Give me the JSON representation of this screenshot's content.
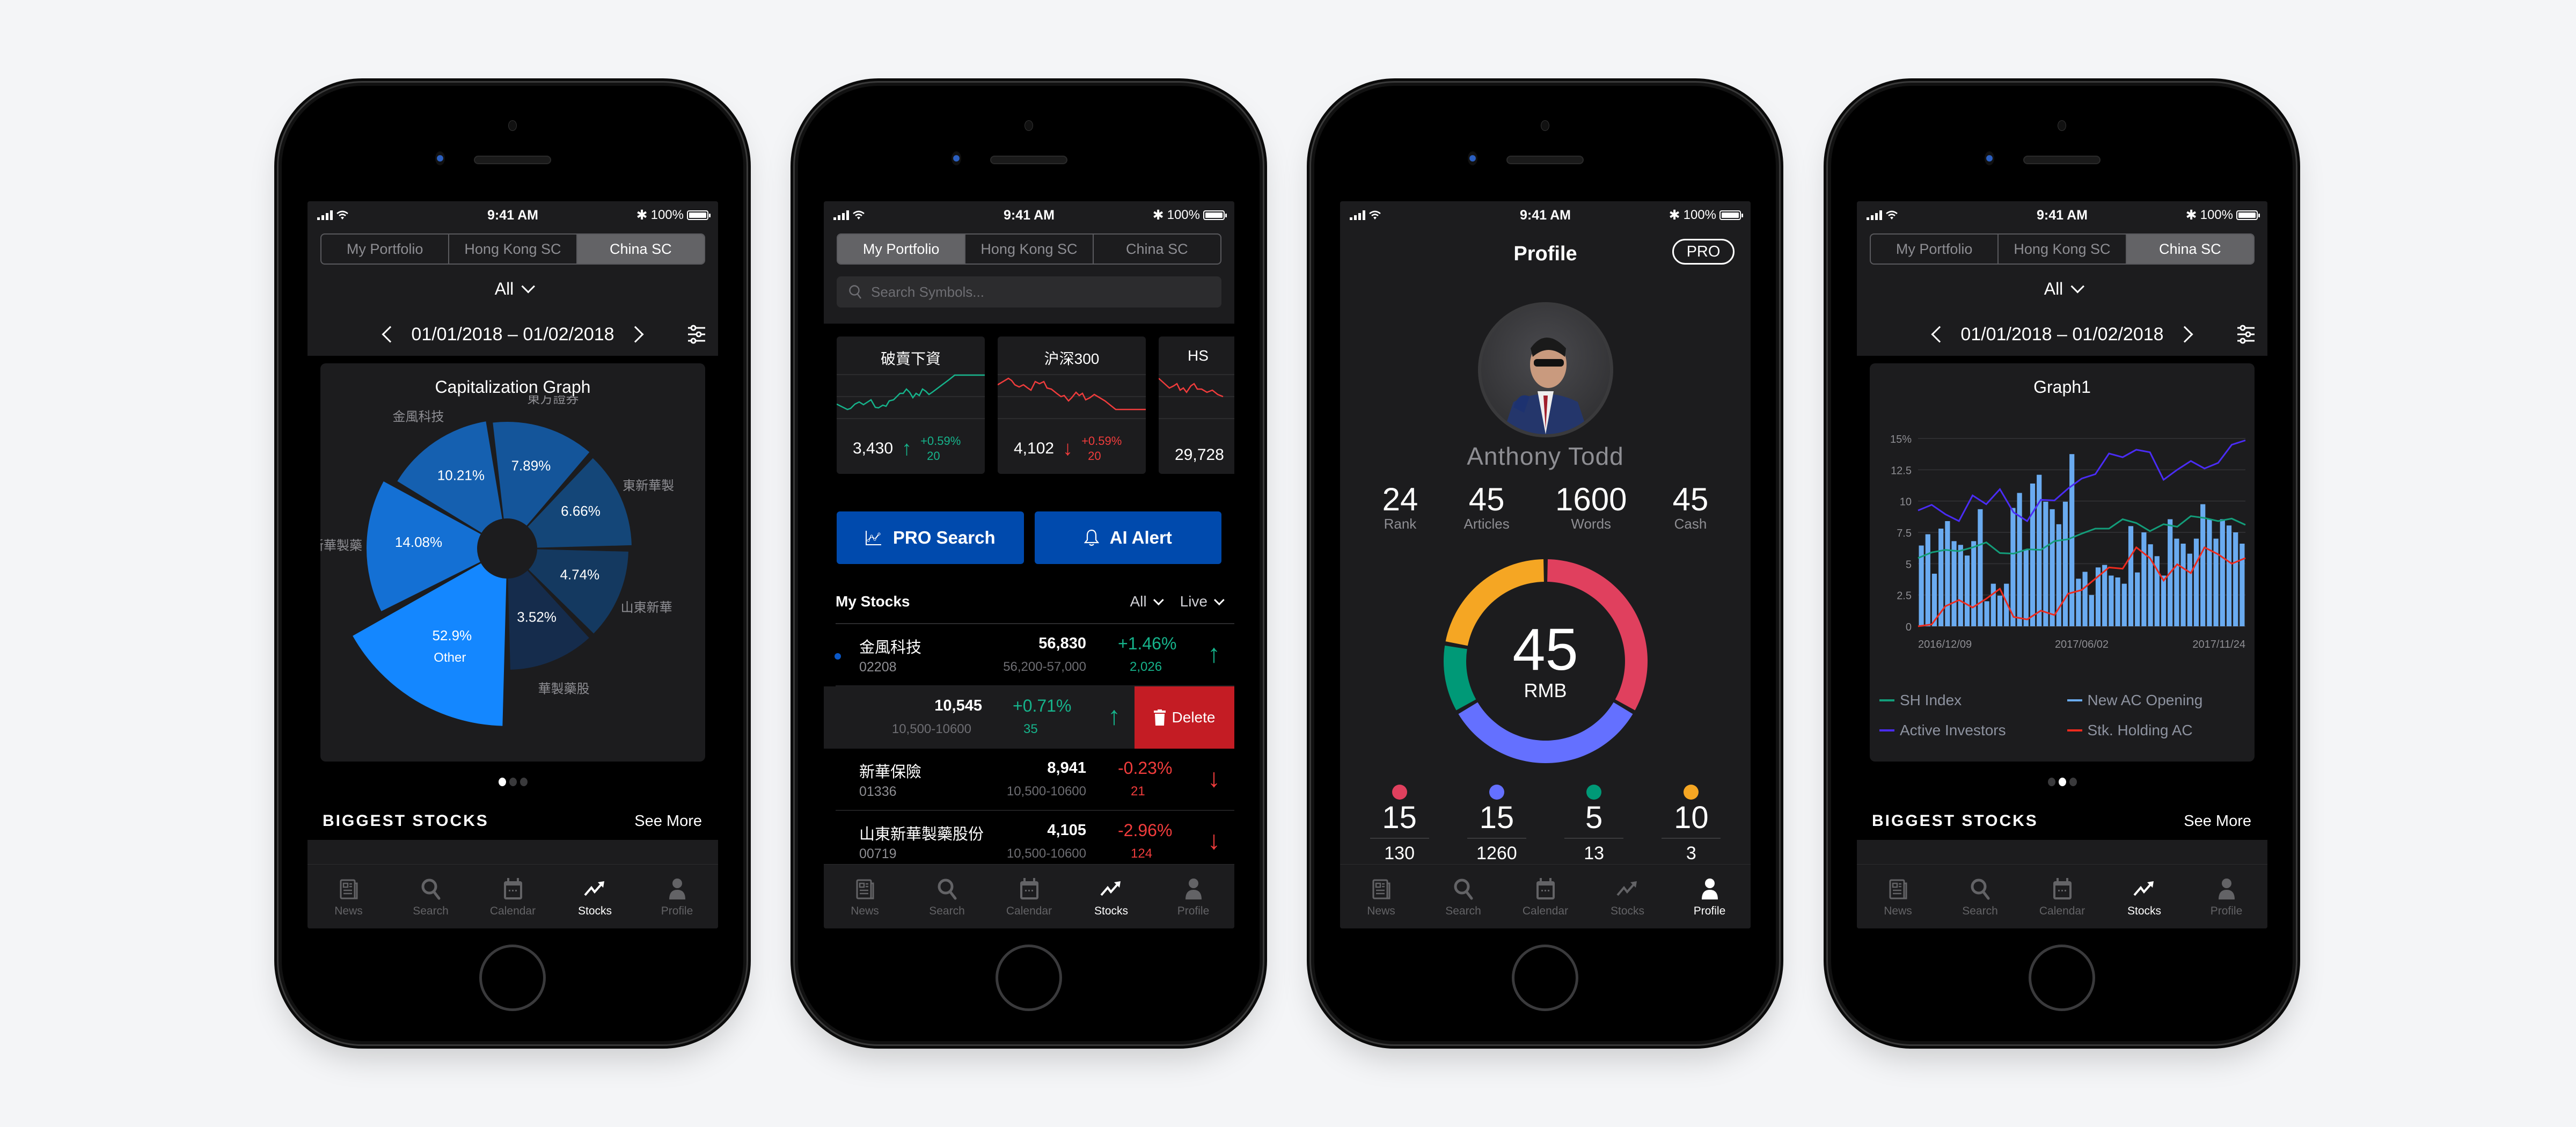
{
  "status_bar": {
    "time": "9:41 AM",
    "battery": "100%"
  },
  "segments": [
    "My Portfolio",
    "Hong Kong SC",
    "China SC"
  ],
  "tabbar": [
    {
      "label": "News",
      "icon": "news-icon"
    },
    {
      "label": "Search",
      "icon": "search-icon"
    },
    {
      "label": "Calendar",
      "icon": "calendar-icon"
    },
    {
      "label": "Stocks",
      "icon": "trending-up-icon"
    },
    {
      "label": "Profile",
      "icon": "person-icon"
    }
  ],
  "phone1": {
    "active_segment": "China SC",
    "filter": "All",
    "date_range": "01/01/2018 – 01/02/2018",
    "page_dots": {
      "count": 3,
      "active": 1
    },
    "biggest_stocks": "BIGGEST STOCKS",
    "see_more": "See More",
    "active_tab": "Stocks"
  },
  "phone2": {
    "active_segment": "My Portfolio",
    "search_placeholder": "Search Symbols...",
    "index_cards": [
      {
        "name": "破賣下資",
        "value": "3,430",
        "change_pct": "+0.59%",
        "change": "20",
        "direction": "up"
      },
      {
        "name": "沪深300",
        "value": "4,102",
        "change_pct": "+0.59%",
        "change": "20",
        "direction": "down"
      },
      {
        "name": "HS",
        "value": "29,728",
        "change_pct": "",
        "change": "",
        "direction": "down"
      }
    ],
    "pro_search": "PRO Search",
    "ai_alert": "AI Alert",
    "my_stocks_title": "My Stocks",
    "filter_all": "All",
    "filter_live": "Live",
    "stocks": [
      {
        "name": "金風科技",
        "code": "02208",
        "price": "56,830",
        "range": "56,200-57,000",
        "pct": "+1.46%",
        "vol": "2,026",
        "direction": "up"
      },
      {
        "name": "",
        "code": "",
        "price": "10,545",
        "range": "10,500-10600",
        "pct": "+0.71%",
        "vol": "35",
        "direction": "up",
        "swiped": true
      },
      {
        "name": "新華保險",
        "code": "01336",
        "price": "8,941",
        "range": "10,500-10600",
        "pct": "-0.23%",
        "vol": "21",
        "direction": "down"
      },
      {
        "name": "山東新華製藥股份",
        "code": "00719",
        "price": "4,105",
        "range": "10,500-10600",
        "pct": "-2.96%",
        "vol": "124",
        "direction": "down"
      }
    ],
    "delete_label": "Delete",
    "active_tab": "Stocks"
  },
  "phone3": {
    "title": "Profile",
    "pro_badge": "PRO",
    "user_name": "Anthony Todd",
    "stats": [
      {
        "value": "24",
        "label": "Rank"
      },
      {
        "value": "45",
        "label": "Articles"
      },
      {
        "value": "1600",
        "label": "Words"
      },
      {
        "value": "45",
        "label": "Cash"
      }
    ],
    "donut": {
      "total": "45",
      "unit": "RMB",
      "segments": [
        {
          "value": 15,
          "sub": "130",
          "color": "#e0405e"
        },
        {
          "value": 15,
          "sub": "1260",
          "color": "#6470ff"
        },
        {
          "value": 5,
          "sub": "13",
          "color": "#009977"
        },
        {
          "value": 10,
          "sub": "3",
          "color": "#f5a623"
        }
      ]
    },
    "active_tab": "Profile"
  },
  "phone4": {
    "active_segment": "China SC",
    "filter": "All",
    "date_range": "01/01/2018 – 01/02/2018",
    "page_dots": {
      "count": 3,
      "active": 2
    },
    "biggest_stocks": "BIGGEST STOCKS",
    "see_more": "See More",
    "active_tab": "Stocks"
  },
  "chart_data": [
    {
      "type": "pie",
      "title": "Capitalization Graph",
      "style": "rose",
      "categories": [
        "Other",
        "新華製藥",
        "金風科技",
        "東方證券",
        "東新華製",
        "山東新華",
        "華製藥股"
      ],
      "values": [
        52.9,
        14.08,
        10.21,
        7.89,
        6.66,
        4.74,
        3.52
      ],
      "labels": [
        "52.9%",
        "14.08%",
        "10.21%",
        "7.89%",
        "6.66%",
        "4.74%",
        "3.52%"
      ],
      "center_note": "Other",
      "colors": [
        "#1487ff",
        "#1470d4",
        "#1560b0",
        "#14559a",
        "#144678",
        "#143960",
        "#152c4c"
      ]
    },
    {
      "type": "bar",
      "title": "Graph1",
      "x_tick_labels": [
        "2016/12/09",
        "2017/06/02",
        "2017/11/24"
      ],
      "y_tick_labels": [
        "0",
        "2.5",
        "5",
        "7.5",
        "10",
        "12.5",
        "15%"
      ],
      "ylim": [
        0,
        15
      ],
      "grid": true,
      "legend_position": "bottom",
      "series": [
        {
          "name": "New AC Opening",
          "type": "bar",
          "color": "#6aabf0",
          "values": [
            6.45,
            7.35,
            4.2,
            7.8,
            8.4,
            6.8,
            6.5,
            5.65,
            6.8,
            9.35,
            2.0,
            3.4,
            2.45,
            3.4,
            9.45,
            10.65,
            6.1,
            11.4,
            12.1,
            9.95,
            9.35,
            8.15,
            9.95,
            13.75,
            3.8,
            4.35,
            2.5,
            4.7,
            4.9,
            4.05,
            3.9,
            3.4,
            8.0,
            4.3,
            7.5,
            6.55,
            5.6,
            4.05,
            8.55,
            7.0,
            6.6,
            5.8,
            7.0,
            9.75,
            8.55,
            7.0,
            8.55,
            8.05,
            7.5,
            6.6
          ]
        },
        {
          "name": "Active Investors",
          "type": "line",
          "color": "#4a2cf5",
          "values": [
            9.25,
            9.7,
            8.95,
            8.4,
            10.45,
            9.75,
            10.95,
            9.1,
            8.4,
            10.1,
            10.05,
            11.0,
            11.8,
            12.15,
            13.8,
            13.5,
            14.1,
            13.9,
            11.7,
            12.5,
            13.2,
            12.6,
            13.05,
            14.5,
            14.85
          ]
        },
        {
          "name": "SH Index",
          "type": "line",
          "color": "#139d7a",
          "values": [
            5.45,
            5.9,
            6.1,
            6.0,
            6.3,
            6.7,
            5.85,
            5.8,
            6.15,
            6.1,
            6.8,
            6.95,
            7.4,
            7.8,
            7.8,
            8.55,
            8.25,
            7.6,
            8.15,
            7.95,
            8.8,
            8.65,
            8.4,
            8.6,
            8.1
          ]
        },
        {
          "name": "Stk. Holding AC",
          "type": "line",
          "color": "#ee2b1e",
          "values": [
            0.0,
            0.15,
            1.6,
            2.1,
            1.5,
            2.2,
            3.0,
            0.75,
            0.55,
            1.25,
            0.9,
            2.6,
            2.9,
            3.8,
            4.7,
            4.6,
            6.3,
            5.45,
            3.65,
            4.95,
            4.25,
            6.3,
            5.75,
            5.0,
            5.45
          ]
        }
      ]
    }
  ]
}
